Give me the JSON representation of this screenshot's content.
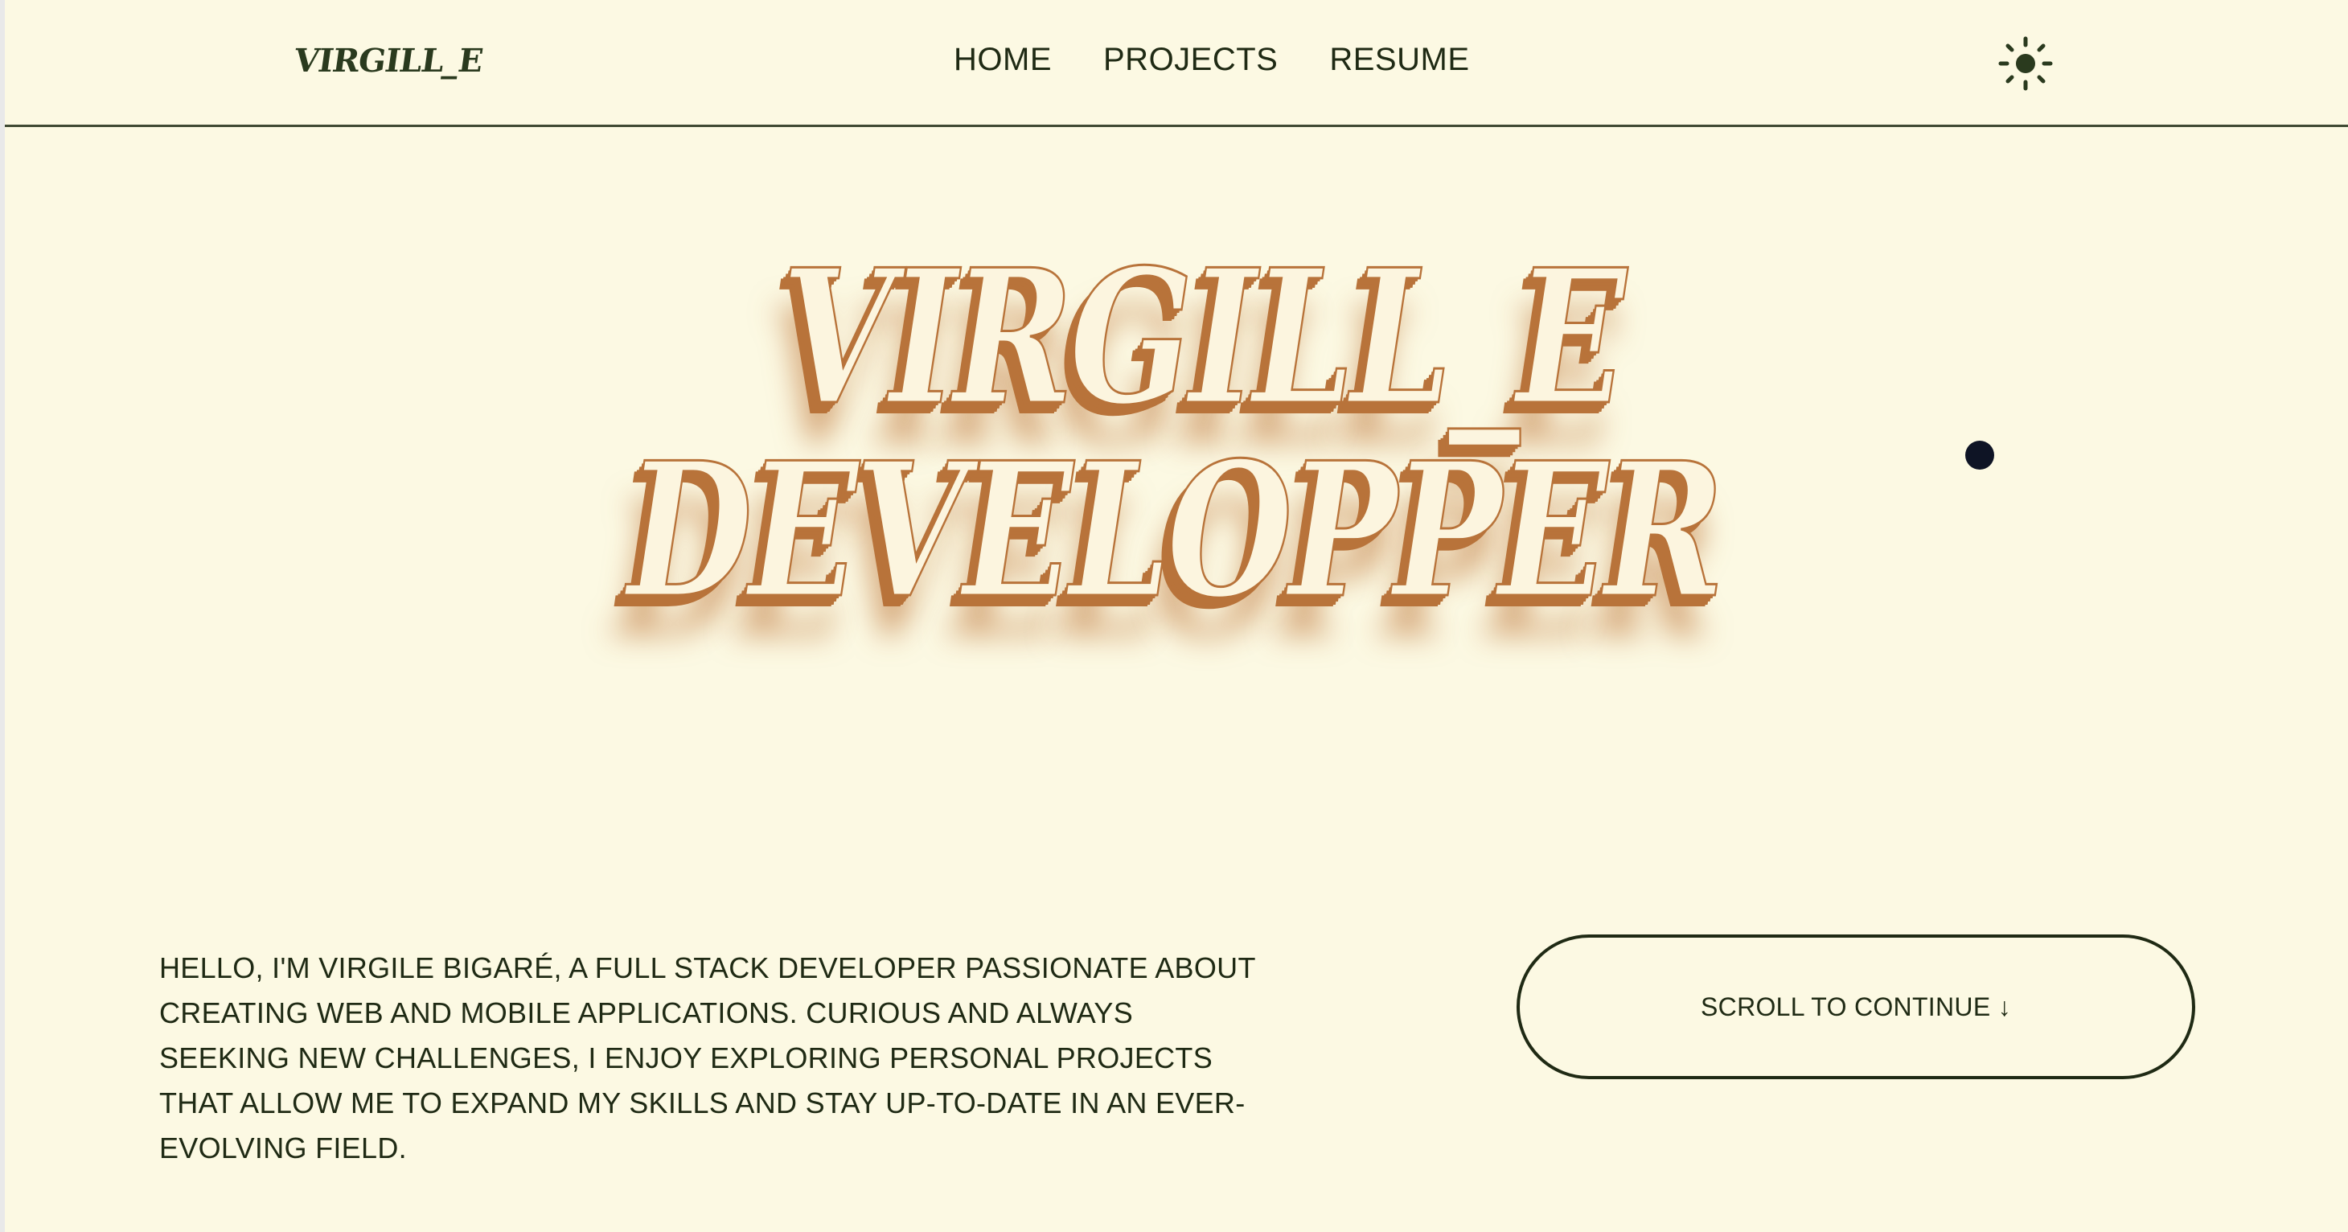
{
  "header": {
    "logo": "VIRGILL_E",
    "nav": [
      {
        "label": "HOME"
      },
      {
        "label": "PROJECTS"
      },
      {
        "label": "RESUME"
      }
    ],
    "theme_toggle_icon": "sun-icon"
  },
  "hero": {
    "line1": "VIRGILL_E",
    "line2": "DEVELOPPER"
  },
  "intro": {
    "text": "HELLO, I'M VIRGILE BIGARÉ, A FULL STACK DEVELOPER PASSIONATE ABOUT CREATING WEB AND MOBILE APPLICATIONS. CURIOUS AND ALWAYS SEEKING NEW CHALLENGES, I ENJOY EXPLORING PERSONAL PROJECTS THAT ALLOW ME TO EXPAND MY SKILLS AND STAY UP-TO-DATE IN AN EVER-EVOLVING FIELD."
  },
  "scroll_button": {
    "label": "SCROLL TO CONTINUE ↓"
  },
  "colors": {
    "background": "#fcf9e3",
    "text": "#1f2a14",
    "accent": "#b8733a",
    "cursor": "#0e1425"
  }
}
